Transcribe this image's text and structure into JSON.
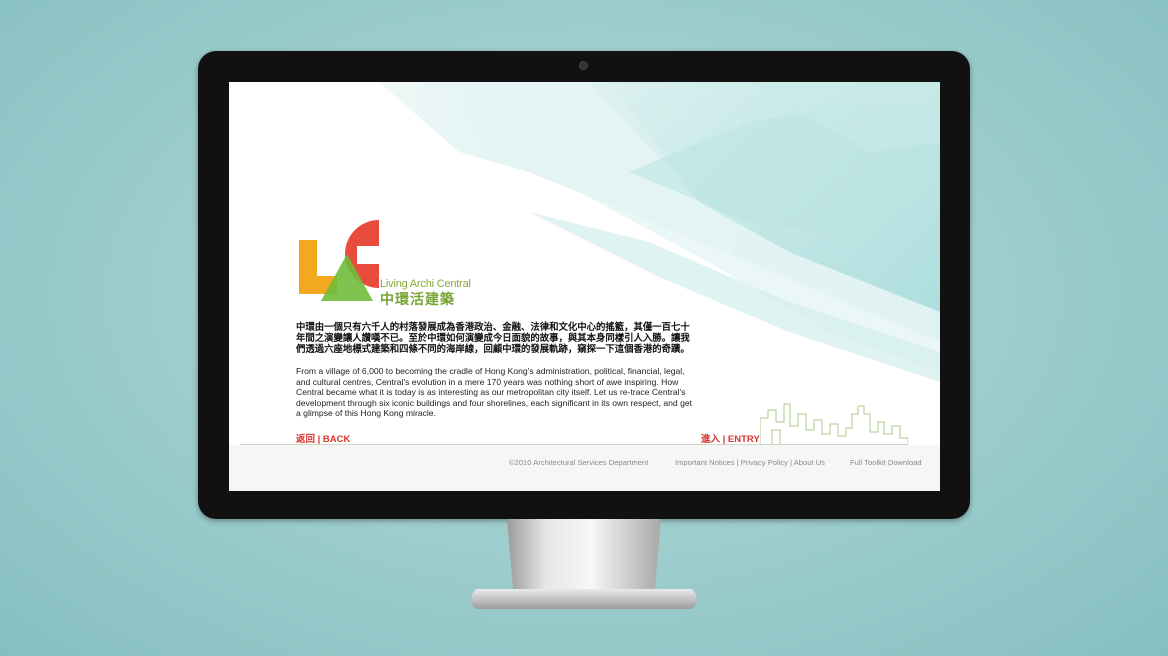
{
  "site": {
    "logo_letters": "LAC",
    "logo_en": "Living Archi Central",
    "logo_zh": "中環活建築"
  },
  "intro": {
    "zh": "中環由一個只有六千人的村落發展成為香港政治、金融、法律和文化中心的搖籃，其僅一百七十年間之演變讓人讚嘆不已。至於中環如何演變成今日面貌的故事，與其本身同樣引人入勝。讓我們透過六座地標式建築和四條不同的海岸線，回顧中環的發展軌跡，窺探一下這個香港的奇蹟。",
    "en": "From a village of 6,000 to becoming the cradle of Hong Kong's administration, political, financial, legal, and cultural centres, Central's evolution in a mere 170 years was nothing short of awe inspiring. How Central became what it is today is as interesting as our metropolitan city itself. Let us re-trace Central's development through six iconic buildings and four shorelines, each significant in its own respect, and get a glimpse of this Hong Kong miracle."
  },
  "nav": {
    "back": "返回 | BACK",
    "entry": "進入 | ENTRY"
  },
  "footer": {
    "copyright": "©2010 Architectural Services Department",
    "links": "Important Notices | Privacy Policy | About Us",
    "toolkit": "Full Toolkit Download"
  },
  "colors": {
    "accent_red": "#d8352c",
    "logo_orange": "#f2a81f",
    "logo_green": "#6fbd3a",
    "logo_red": "#e74c3c",
    "backdrop": "#9ccccd"
  }
}
